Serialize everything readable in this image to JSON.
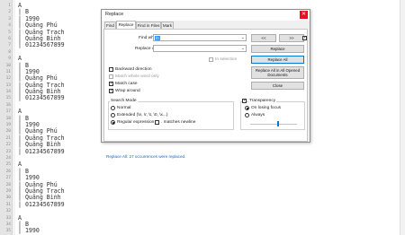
{
  "editor": {
    "line_numbers": [
      "1",
      "2",
      "3",
      "4",
      "5",
      "6",
      "7",
      "8",
      "9",
      "10",
      "11",
      "12",
      "13",
      "14",
      "15",
      "16",
      "17",
      "18",
      "19",
      "20",
      "21",
      "22",
      "23",
      "24",
      "25",
      "26",
      "27",
      "28",
      "29",
      "30",
      "31",
      "32",
      "33",
      "34",
      "35"
    ],
    "lines": [
      "A",
      "| B",
      "| 1990",
      "| Quảng Phú",
      "| Quảng Trạch",
      "| Quảng Bình",
      "| 01234567899",
      "",
      "A",
      "| B",
      "| 1990",
      "| Quảng Phú",
      "| Quảng Trạch",
      "| Quảng Bình",
      "| 01234567899",
      "",
      "A",
      "| B",
      "| 1990",
      "| Quảng Phú",
      "| Quảng Trạch",
      "| Quảng Bình",
      "| 01234567899",
      "",
      "A",
      "| B",
      "| 1990",
      "| Quảng Phú",
      "| Quảng Trạch",
      "| Quảng Bình",
      "| 01234567899",
      "",
      "A",
      "| B",
      "| 1990"
    ]
  },
  "dialog": {
    "title": "Replace",
    "close_glyph": "✕",
    "tabs": [
      "Find",
      "Replace",
      "Find in Files",
      "Mark"
    ],
    "find_label": "Find what :",
    "find_value": "\\n",
    "replace_label": "Replace with :",
    "replace_value": "",
    "in_selection_label": "In selection",
    "buttons": {
      "prev": "<<",
      "next": ">>",
      "replace": "Replace",
      "replace_all": "Replace All",
      "replace_all_docs": "Replace All in All Opened Documents",
      "close": "Close"
    },
    "options": {
      "backward": "Backward direction",
      "whole_word": "Match whole word only",
      "match_case": "Match case",
      "wrap": "Wrap around"
    },
    "search_mode": {
      "title": "Search Mode",
      "normal": "Normal",
      "extended": "Extended (\\n, \\r, \\t, \\0, \\x...)",
      "regex": "Regular expression",
      "dot_newline": ". matches newline"
    },
    "transparency": {
      "title": "Transparency",
      "on_losing_focus": "On losing focus",
      "always": "Always",
      "level": 0.6
    },
    "status": "Replace All: 27 occurrences were replaced.",
    "dropdown_glyph": "⌄"
  }
}
